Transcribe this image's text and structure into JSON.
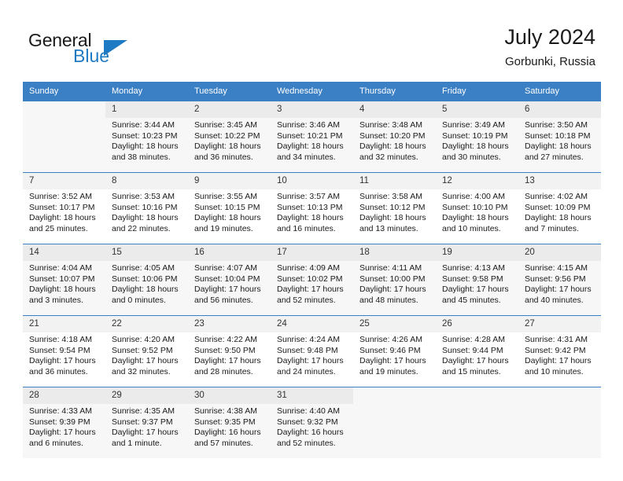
{
  "brand": {
    "name_part1": "General",
    "name_part2": "Blue",
    "accent_color": "#1f7ac4"
  },
  "header": {
    "title": "July 2024",
    "subtitle": "Gorbunki, Russia"
  },
  "calendar": {
    "header_bg": "#3b7fc4",
    "weekday_headers": [
      "Sunday",
      "Monday",
      "Tuesday",
      "Wednesday",
      "Thursday",
      "Friday",
      "Saturday"
    ],
    "weeks": [
      [
        {
          "day": "",
          "sunrise": "",
          "sunset": "",
          "daylight_line1": "",
          "daylight_line2": ""
        },
        {
          "day": "1",
          "sunrise": "Sunrise: 3:44 AM",
          "sunset": "Sunset: 10:23 PM",
          "daylight_line1": "Daylight: 18 hours",
          "daylight_line2": "and 38 minutes."
        },
        {
          "day": "2",
          "sunrise": "Sunrise: 3:45 AM",
          "sunset": "Sunset: 10:22 PM",
          "daylight_line1": "Daylight: 18 hours",
          "daylight_line2": "and 36 minutes."
        },
        {
          "day": "3",
          "sunrise": "Sunrise: 3:46 AM",
          "sunset": "Sunset: 10:21 PM",
          "daylight_line1": "Daylight: 18 hours",
          "daylight_line2": "and 34 minutes."
        },
        {
          "day": "4",
          "sunrise": "Sunrise: 3:48 AM",
          "sunset": "Sunset: 10:20 PM",
          "daylight_line1": "Daylight: 18 hours",
          "daylight_line2": "and 32 minutes."
        },
        {
          "day": "5",
          "sunrise": "Sunrise: 3:49 AM",
          "sunset": "Sunset: 10:19 PM",
          "daylight_line1": "Daylight: 18 hours",
          "daylight_line2": "and 30 minutes."
        },
        {
          "day": "6",
          "sunrise": "Sunrise: 3:50 AM",
          "sunset": "Sunset: 10:18 PM",
          "daylight_line1": "Daylight: 18 hours",
          "daylight_line2": "and 27 minutes."
        }
      ],
      [
        {
          "day": "7",
          "sunrise": "Sunrise: 3:52 AM",
          "sunset": "Sunset: 10:17 PM",
          "daylight_line1": "Daylight: 18 hours",
          "daylight_line2": "and 25 minutes."
        },
        {
          "day": "8",
          "sunrise": "Sunrise: 3:53 AM",
          "sunset": "Sunset: 10:16 PM",
          "daylight_line1": "Daylight: 18 hours",
          "daylight_line2": "and 22 minutes."
        },
        {
          "day": "9",
          "sunrise": "Sunrise: 3:55 AM",
          "sunset": "Sunset: 10:15 PM",
          "daylight_line1": "Daylight: 18 hours",
          "daylight_line2": "and 19 minutes."
        },
        {
          "day": "10",
          "sunrise": "Sunrise: 3:57 AM",
          "sunset": "Sunset: 10:13 PM",
          "daylight_line1": "Daylight: 18 hours",
          "daylight_line2": "and 16 minutes."
        },
        {
          "day": "11",
          "sunrise": "Sunrise: 3:58 AM",
          "sunset": "Sunset: 10:12 PM",
          "daylight_line1": "Daylight: 18 hours",
          "daylight_line2": "and 13 minutes."
        },
        {
          "day": "12",
          "sunrise": "Sunrise: 4:00 AM",
          "sunset": "Sunset: 10:10 PM",
          "daylight_line1": "Daylight: 18 hours",
          "daylight_line2": "and 10 minutes."
        },
        {
          "day": "13",
          "sunrise": "Sunrise: 4:02 AM",
          "sunset": "Sunset: 10:09 PM",
          "daylight_line1": "Daylight: 18 hours",
          "daylight_line2": "and 7 minutes."
        }
      ],
      [
        {
          "day": "14",
          "sunrise": "Sunrise: 4:04 AM",
          "sunset": "Sunset: 10:07 PM",
          "daylight_line1": "Daylight: 18 hours",
          "daylight_line2": "and 3 minutes."
        },
        {
          "day": "15",
          "sunrise": "Sunrise: 4:05 AM",
          "sunset": "Sunset: 10:06 PM",
          "daylight_line1": "Daylight: 18 hours",
          "daylight_line2": "and 0 minutes."
        },
        {
          "day": "16",
          "sunrise": "Sunrise: 4:07 AM",
          "sunset": "Sunset: 10:04 PM",
          "daylight_line1": "Daylight: 17 hours",
          "daylight_line2": "and 56 minutes."
        },
        {
          "day": "17",
          "sunrise": "Sunrise: 4:09 AM",
          "sunset": "Sunset: 10:02 PM",
          "daylight_line1": "Daylight: 17 hours",
          "daylight_line2": "and 52 minutes."
        },
        {
          "day": "18",
          "sunrise": "Sunrise: 4:11 AM",
          "sunset": "Sunset: 10:00 PM",
          "daylight_line1": "Daylight: 17 hours",
          "daylight_line2": "and 48 minutes."
        },
        {
          "day": "19",
          "sunrise": "Sunrise: 4:13 AM",
          "sunset": "Sunset: 9:58 PM",
          "daylight_line1": "Daylight: 17 hours",
          "daylight_line2": "and 45 minutes."
        },
        {
          "day": "20",
          "sunrise": "Sunrise: 4:15 AM",
          "sunset": "Sunset: 9:56 PM",
          "daylight_line1": "Daylight: 17 hours",
          "daylight_line2": "and 40 minutes."
        }
      ],
      [
        {
          "day": "21",
          "sunrise": "Sunrise: 4:18 AM",
          "sunset": "Sunset: 9:54 PM",
          "daylight_line1": "Daylight: 17 hours",
          "daylight_line2": "and 36 minutes."
        },
        {
          "day": "22",
          "sunrise": "Sunrise: 4:20 AM",
          "sunset": "Sunset: 9:52 PM",
          "daylight_line1": "Daylight: 17 hours",
          "daylight_line2": "and 32 minutes."
        },
        {
          "day": "23",
          "sunrise": "Sunrise: 4:22 AM",
          "sunset": "Sunset: 9:50 PM",
          "daylight_line1": "Daylight: 17 hours",
          "daylight_line2": "and 28 minutes."
        },
        {
          "day": "24",
          "sunrise": "Sunrise: 4:24 AM",
          "sunset": "Sunset: 9:48 PM",
          "daylight_line1": "Daylight: 17 hours",
          "daylight_line2": "and 24 minutes."
        },
        {
          "day": "25",
          "sunrise": "Sunrise: 4:26 AM",
          "sunset": "Sunset: 9:46 PM",
          "daylight_line1": "Daylight: 17 hours",
          "daylight_line2": "and 19 minutes."
        },
        {
          "day": "26",
          "sunrise": "Sunrise: 4:28 AM",
          "sunset": "Sunset: 9:44 PM",
          "daylight_line1": "Daylight: 17 hours",
          "daylight_line2": "and 15 minutes."
        },
        {
          "day": "27",
          "sunrise": "Sunrise: 4:31 AM",
          "sunset": "Sunset: 9:42 PM",
          "daylight_line1": "Daylight: 17 hours",
          "daylight_line2": "and 10 minutes."
        }
      ],
      [
        {
          "day": "28",
          "sunrise": "Sunrise: 4:33 AM",
          "sunset": "Sunset: 9:39 PM",
          "daylight_line1": "Daylight: 17 hours",
          "daylight_line2": "and 6 minutes."
        },
        {
          "day": "29",
          "sunrise": "Sunrise: 4:35 AM",
          "sunset": "Sunset: 9:37 PM",
          "daylight_line1": "Daylight: 17 hours",
          "daylight_line2": "and 1 minute."
        },
        {
          "day": "30",
          "sunrise": "Sunrise: 4:38 AM",
          "sunset": "Sunset: 9:35 PM",
          "daylight_line1": "Daylight: 16 hours",
          "daylight_line2": "and 57 minutes."
        },
        {
          "day": "31",
          "sunrise": "Sunrise: 4:40 AM",
          "sunset": "Sunset: 9:32 PM",
          "daylight_line1": "Daylight: 16 hours",
          "daylight_line2": "and 52 minutes."
        },
        {
          "day": "",
          "sunrise": "",
          "sunset": "",
          "daylight_line1": "",
          "daylight_line2": ""
        },
        {
          "day": "",
          "sunrise": "",
          "sunset": "",
          "daylight_line1": "",
          "daylight_line2": ""
        },
        {
          "day": "",
          "sunrise": "",
          "sunset": "",
          "daylight_line1": "",
          "daylight_line2": ""
        }
      ]
    ]
  }
}
